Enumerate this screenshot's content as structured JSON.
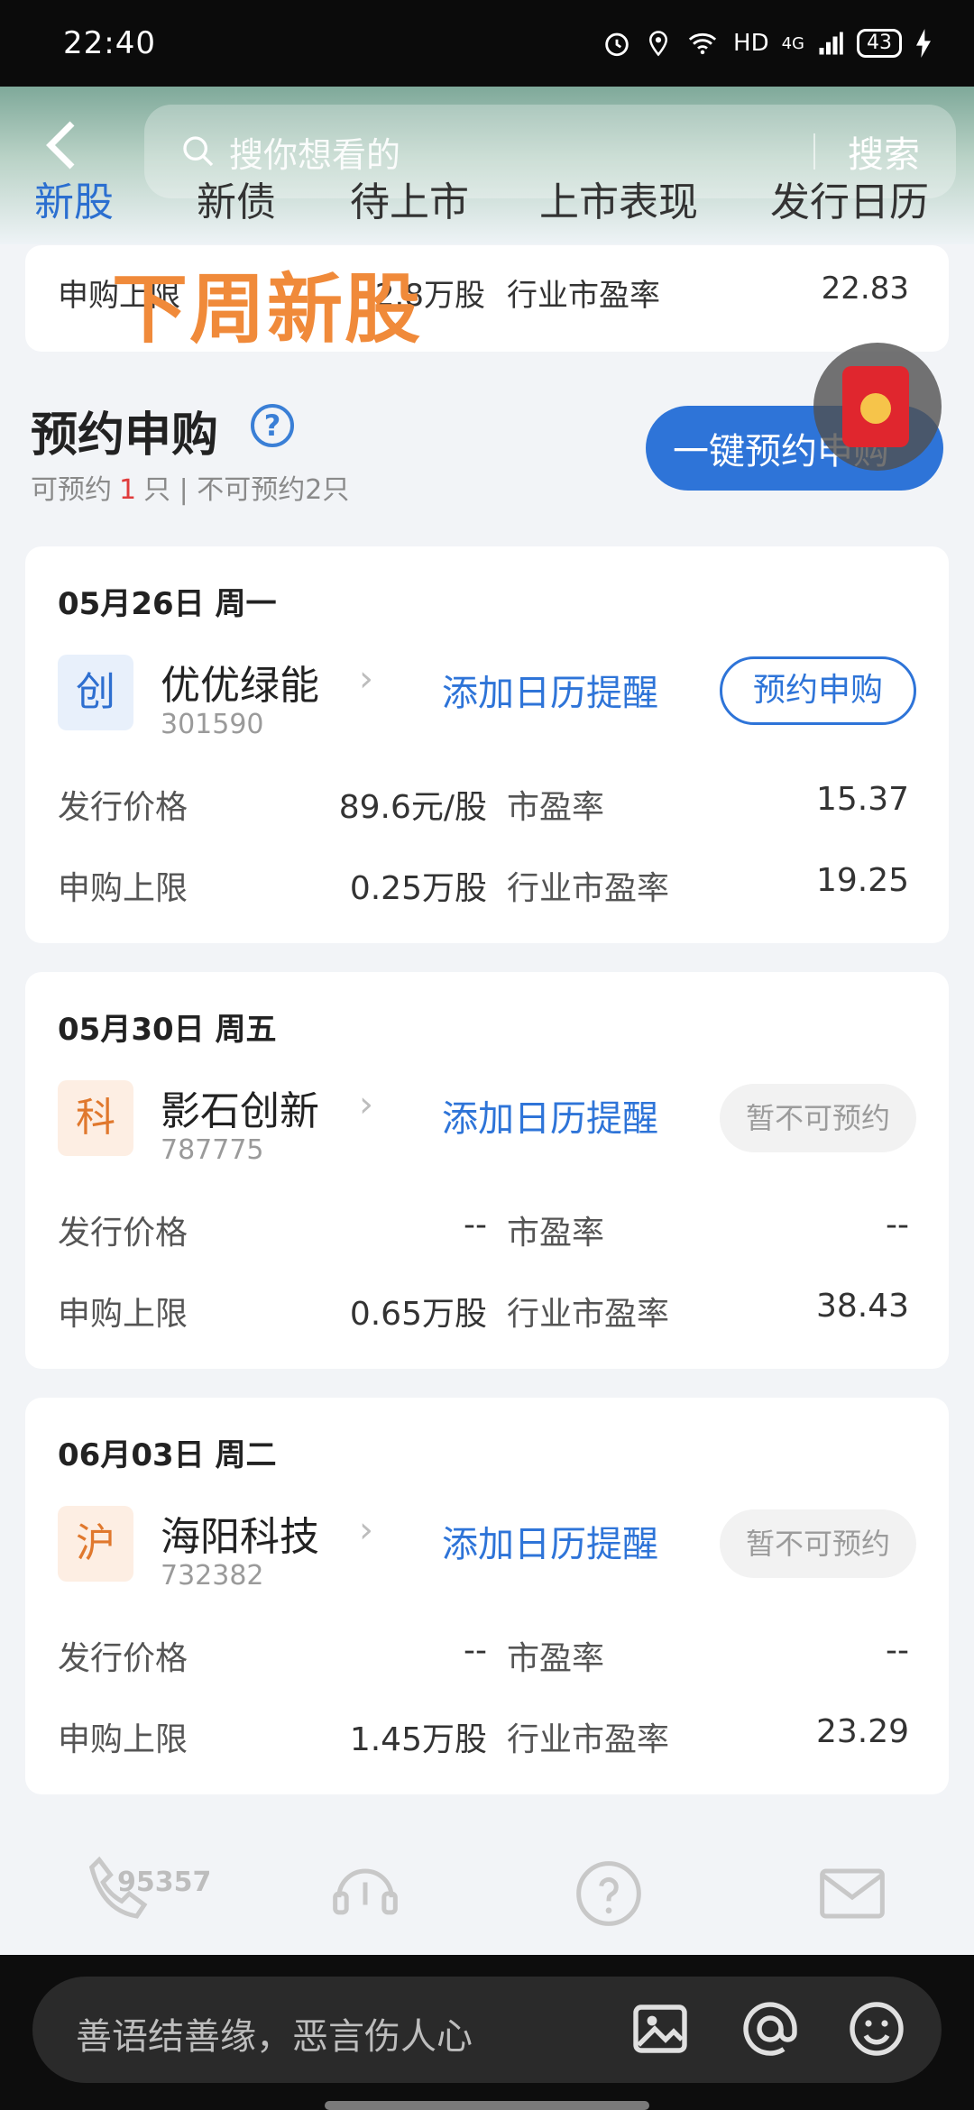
{
  "status": {
    "time": "22:40",
    "network": "HD",
    "signal": "4G",
    "battery": "43"
  },
  "search": {
    "placeholder": "搜你想看的",
    "button": "搜索"
  },
  "tabs": [
    {
      "label": "新股",
      "active": true
    },
    {
      "label": "新债",
      "active": false
    },
    {
      "label": "待上市",
      "active": false
    },
    {
      "label": "上市表现",
      "active": false
    },
    {
      "label": "发行日历",
      "active": false
    }
  ],
  "overlay_caption": "下周新股",
  "previous_card": {
    "limit_label": "申购上限",
    "limit_value": "2.8万股",
    "industry_pe_label": "行业市盈率",
    "industry_pe_value": "22.83"
  },
  "section": {
    "title": "预约申购",
    "help_glyph": "?",
    "available_prefix": "可预约",
    "available_count": "1",
    "available_suffix": "只 | 不可预约2只",
    "one_key_button": "一键预约申购"
  },
  "stocks": [
    {
      "date": "05月26日 周一",
      "board": "创",
      "name": "优优绿能",
      "code": "301590",
      "calendar_link": "添加日历提醒",
      "action": "预约申购",
      "action_enabled": true,
      "issue_price_label": "发行价格",
      "issue_price": "89.6元/股",
      "pe_label": "市盈率",
      "pe": "15.37",
      "limit_label": "申购上限",
      "limit": "0.25万股",
      "industry_pe_label": "行业市盈率",
      "industry_pe": "19.25"
    },
    {
      "date": "05月30日 周五",
      "board": "科",
      "name": "影石创新",
      "code": "787775",
      "calendar_link": "添加日历提醒",
      "action": "暂不可预约",
      "action_enabled": false,
      "issue_price_label": "发行价格",
      "issue_price": "--",
      "pe_label": "市盈率",
      "pe": "--",
      "limit_label": "申购上限",
      "limit": "0.65万股",
      "industry_pe_label": "行业市盈率",
      "industry_pe": "38.43"
    },
    {
      "date": "06月03日 周二",
      "board": "沪",
      "name": "海阳科技",
      "code": "732382",
      "calendar_link": "添加日历提醒",
      "action": "暂不可预约",
      "action_enabled": false,
      "issue_price_label": "发行价格",
      "issue_price": "--",
      "pe_label": "市盈率",
      "pe": "--",
      "limit_label": "申购上限",
      "limit": "1.45万股",
      "industry_pe_label": "行业市盈率",
      "industry_pe": "23.29"
    }
  ],
  "footer": {
    "phone_number": "95357",
    "icons": [
      "phone-icon",
      "headset-icon",
      "help-icon",
      "mail-icon"
    ]
  },
  "comment": {
    "placeholder": "善语结善缘，恶言伤人心",
    "icons": [
      "image-icon",
      "at-icon",
      "emoji-icon"
    ]
  },
  "colors": {
    "accent": "#2e74d8",
    "overlay_orange": "#f08a3a",
    "warn_red": "#e03c3c"
  }
}
